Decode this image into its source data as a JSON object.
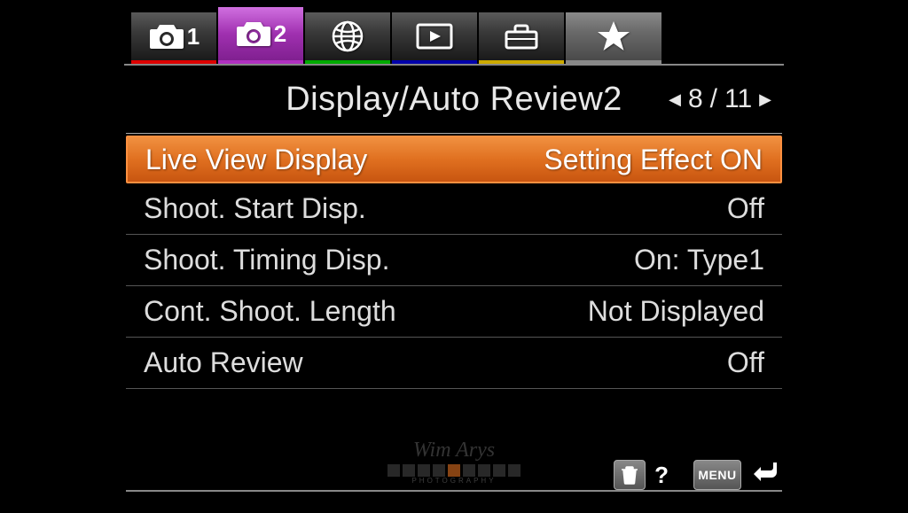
{
  "tabs": {
    "camera1_num": "1",
    "camera2_num": "2"
  },
  "header": {
    "title": "Display/Auto Review2",
    "page_current": "8",
    "page_total": "11",
    "page_sep": "/"
  },
  "menu": [
    {
      "label": "Live View Display",
      "value": "Setting Effect ON",
      "selected": true
    },
    {
      "label": "Shoot. Start Disp.",
      "value": "Off",
      "selected": false
    },
    {
      "label": "Shoot. Timing Disp.",
      "value": "On: Type1",
      "selected": false
    },
    {
      "label": "Cont. Shoot. Length",
      "value": "Not Displayed",
      "selected": false
    },
    {
      "label": "Auto Review",
      "value": "Off",
      "selected": false
    }
  ],
  "footer": {
    "menu_label": "MENU",
    "help_label": "?"
  },
  "watermark": {
    "text": "Wim Arys",
    "subtext": "PHOTOGRAPHY"
  }
}
